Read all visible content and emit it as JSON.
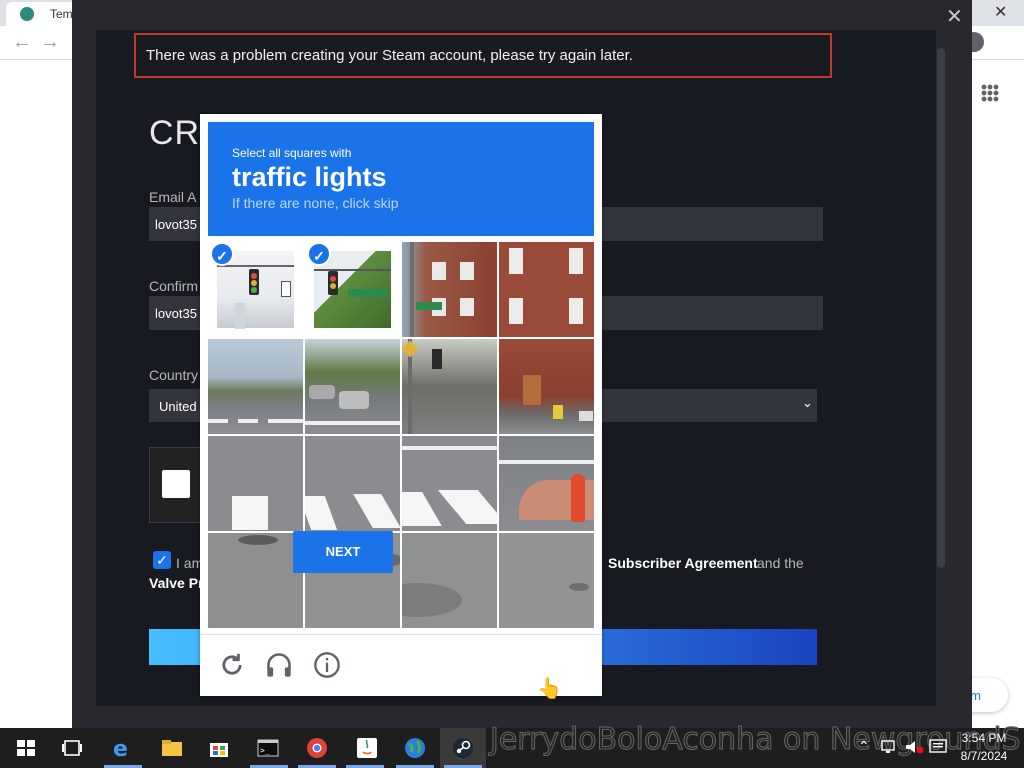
{
  "browser": {
    "tab_title": "Temp",
    "back_icon": "arrow-left-icon",
    "forward_icon": "arrow-right-icon",
    "minimize": "—",
    "close": "✕",
    "side_pill_text": "ium"
  },
  "steam": {
    "error_message": "There was a problem creating your Steam account, please try again later.",
    "title": "CRI",
    "email_label": "Email A",
    "email_value": "lovot35",
    "confirm_label": "Confirm",
    "confirm_value": "lovot35",
    "country_label": "Country",
    "country_value": "United",
    "agree_prefix": "I am",
    "agree_link": "Subscriber Agreement",
    "agree_suffix": "and the",
    "privacy_line": "Valve Pr",
    "close_icon": "close-icon"
  },
  "captcha": {
    "instruction": "Select all squares with",
    "target": "traffic lights",
    "hint": "If there are none, click skip",
    "selected_tiles": [
      0,
      1
    ],
    "next_label": "NEXT",
    "accent": "#1a73e8",
    "icons": [
      "reload-icon",
      "headphones-icon",
      "info-icon"
    ]
  },
  "taskbar": {
    "watermark": "JerrydoBoloAconha on NewgroundS",
    "time": "3:54 PM",
    "date": "8/7/2024",
    "icons": [
      "windows-start-icon",
      "task-view-icon",
      "edge-icon",
      "file-explorer-icon",
      "store-icon",
      "terminal-icon",
      "chrome-icon",
      "java-icon",
      "globe-icon",
      "steam-icon"
    ]
  }
}
